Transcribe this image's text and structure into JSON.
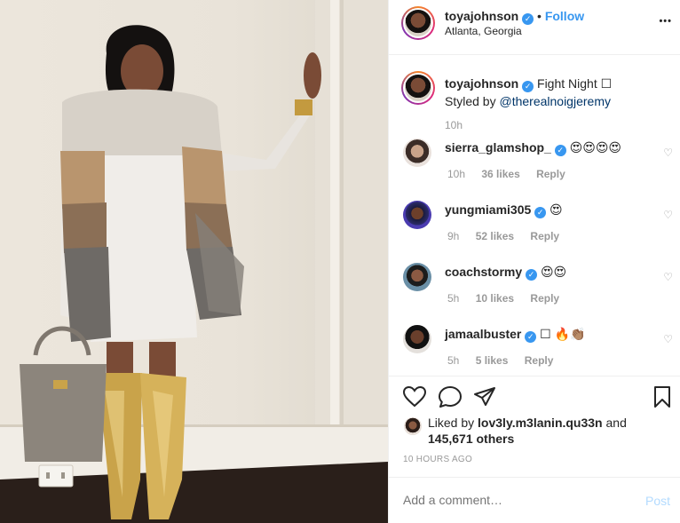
{
  "header": {
    "username": "toyajohnson",
    "separator": "•",
    "follow_label": "Follow",
    "location": "Atlanta, Georgia",
    "more_label": "•••"
  },
  "caption": {
    "username": "toyajohnson",
    "text": "Fight Night ☐",
    "styled_by": "Styled by ",
    "mention": "@therealnoigjeremy",
    "time": "10h"
  },
  "comments": [
    {
      "username": "sierra_glamshop_",
      "verified": true,
      "text": "😍😍😍😍",
      "time": "10h",
      "likes": "36 likes",
      "reply": "Reply"
    },
    {
      "username": "yungmiami305",
      "verified": true,
      "text": "😍",
      "time": "9h",
      "likes": "52 likes",
      "reply": "Reply"
    },
    {
      "username": "coachstormy",
      "verified": true,
      "text": "😍😍",
      "time": "5h",
      "likes": "10 likes",
      "reply": "Reply"
    },
    {
      "username": "jamaalbuster",
      "verified": true,
      "text": "☐ 🔥👏🏽",
      "time": "5h",
      "likes": "5 likes",
      "reply": "Reply"
    }
  ],
  "actions": {
    "liked_prefix": "Liked by ",
    "liked_user": "lov3ly.m3lanin.qu33n",
    "liked_and": " and",
    "liked_count": "145,671 others",
    "time_ago": "10 HOURS AGO"
  },
  "comment_box": {
    "placeholder": "Add a comment…",
    "post_label": "Post"
  },
  "icons": {
    "heart": "heart-icon",
    "comment": "comment-icon",
    "share": "share-icon",
    "bookmark": "bookmark-icon",
    "verified": "verified-badge-icon"
  },
  "colors": {
    "accent": "#3897f0",
    "muted": "#999999",
    "post_disabled": "#b3dbff"
  }
}
